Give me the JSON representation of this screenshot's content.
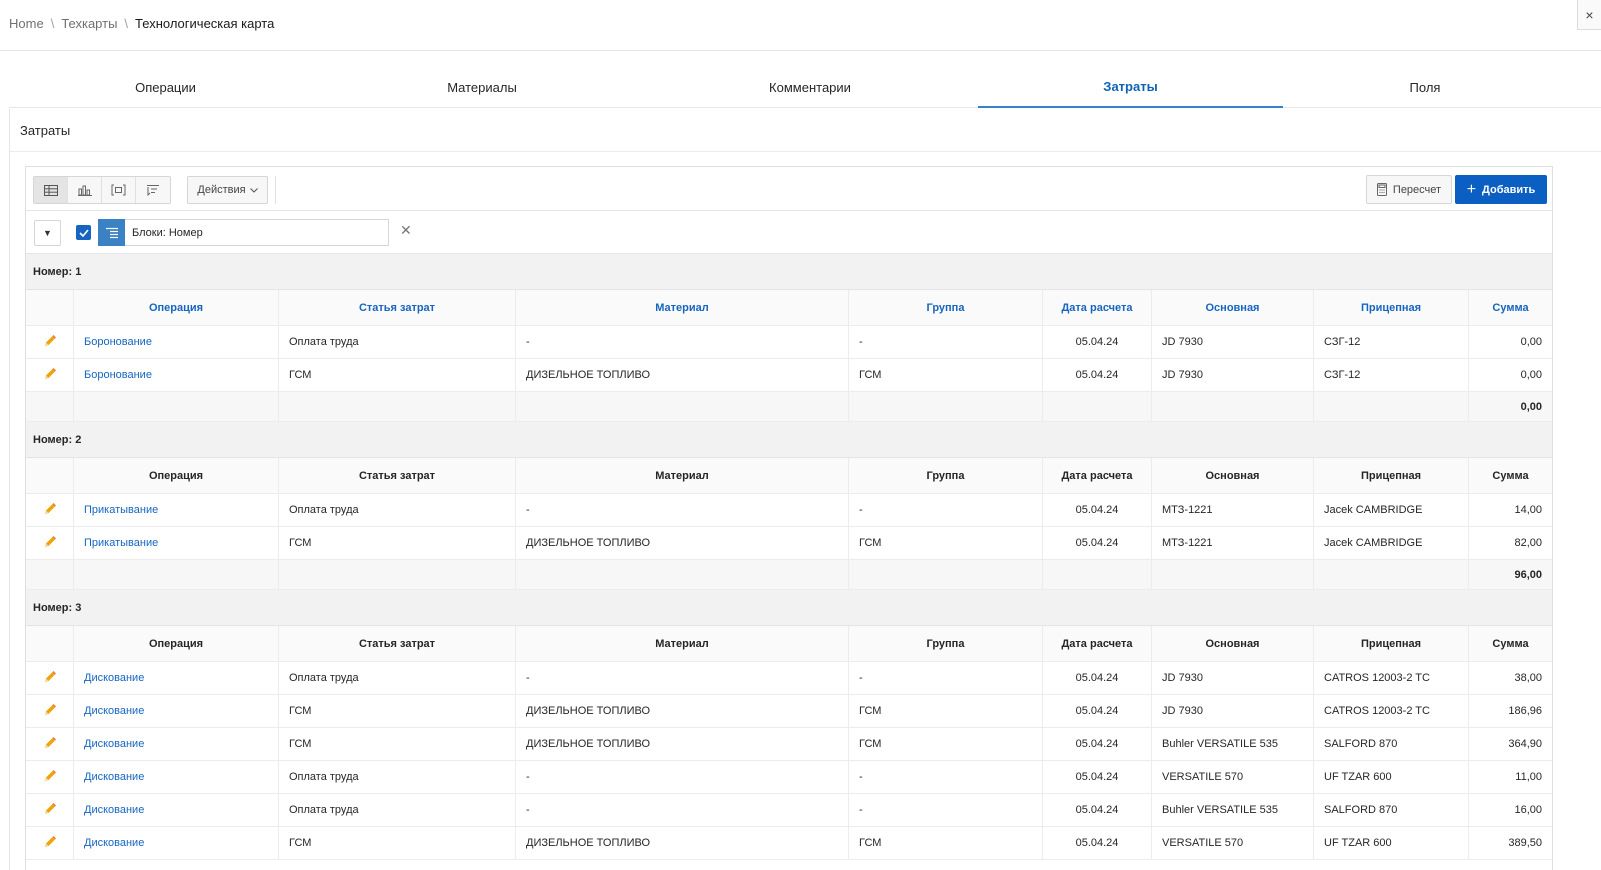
{
  "breadcrumb": {
    "items": [
      "Home",
      "Техкарты"
    ],
    "current": "Технологическая карта",
    "separator": "\\"
  },
  "close_label": "×",
  "tabs": [
    {
      "label": "Операции"
    },
    {
      "label": "Материалы"
    },
    {
      "label": "Комментарии"
    },
    {
      "label": "Затраты"
    },
    {
      "label": "Поля"
    }
  ],
  "active_tab": "Затраты",
  "region": {
    "title": "Затраты"
  },
  "toolbar": {
    "actions_label": "Действия",
    "recalc_label": "Пересчет",
    "add_label": "Добавить",
    "view_icons": [
      "grid-view-icon",
      "chart-view-icon",
      "detail-view-icon",
      "group-by-view-icon"
    ]
  },
  "filter": {
    "text": "Блоки: Номер",
    "checked": true
  },
  "columns": [
    "Операция",
    "Статья затрат",
    "Материал",
    "Группа",
    "Дата расчета",
    "Основная",
    "Прицепная",
    "Сумма"
  ],
  "blocks": [
    {
      "label": "Номер: 1",
      "header_linked": true,
      "rows": [
        [
          "Боронование",
          "Оплата труда",
          "-",
          "-",
          "05.04.24",
          "JD 7930",
          "СЗГ-12",
          "0,00"
        ],
        [
          "Боронование",
          "ГСМ",
          "ДИЗЕЛЬНОЕ ТОПЛИВО",
          "ГСМ",
          "05.04.24",
          "JD 7930",
          "СЗГ-12",
          "0,00"
        ]
      ],
      "total": "0,00"
    },
    {
      "label": "Номер: 2",
      "header_linked": false,
      "rows": [
        [
          "Прикатывание",
          "Оплата труда",
          "-",
          "-",
          "05.04.24",
          "МТЗ-1221",
          "Jacek CAMBRIDGE",
          "14,00"
        ],
        [
          "Прикатывание",
          "ГСМ",
          "ДИЗЕЛЬНОЕ ТОПЛИВО",
          "ГСМ",
          "05.04.24",
          "МТЗ-1221",
          "Jacek CAMBRIDGE",
          "82,00"
        ]
      ],
      "total": "96,00"
    },
    {
      "label": "Номер: 3",
      "header_linked": false,
      "rows": [
        [
          "Дискование",
          "Оплата труда",
          "-",
          "-",
          "05.04.24",
          "JD 7930",
          "CATROS 12003-2 TC",
          "38,00"
        ],
        [
          "Дискование",
          "ГСМ",
          "ДИЗЕЛЬНОЕ ТОПЛИВО",
          "ГСМ",
          "05.04.24",
          "JD 7930",
          "CATROS 12003-2 TC",
          "186,96"
        ],
        [
          "Дискование",
          "ГСМ",
          "ДИЗЕЛЬНОЕ ТОПЛИВО",
          "ГСМ",
          "05.04.24",
          "Buhler VERSATILE 535",
          "SALFORD 870",
          "364,90"
        ],
        [
          "Дискование",
          "Оплата труда",
          "-",
          "-",
          "05.04.24",
          "VERSATILE 570",
          "UF TZAR 600",
          "11,00"
        ],
        [
          "Дискование",
          "Оплата труда",
          "-",
          "-",
          "05.04.24",
          "Buhler VERSATILE 535",
          "SALFORD 870",
          "16,00"
        ],
        [
          "Дискование",
          "ГСМ",
          "ДИЗЕЛЬНОЕ ТОПЛИВО",
          "ГСМ",
          "05.04.24",
          "VERSATILE 570",
          "UF TZAR 600",
          "389,50"
        ]
      ],
      "total": null
    }
  ],
  "colors": {
    "accent": "#0b5fc3",
    "link": "#1665c0",
    "tab_active": "#0f62b8",
    "edit_icon": "#f0a30a"
  }
}
